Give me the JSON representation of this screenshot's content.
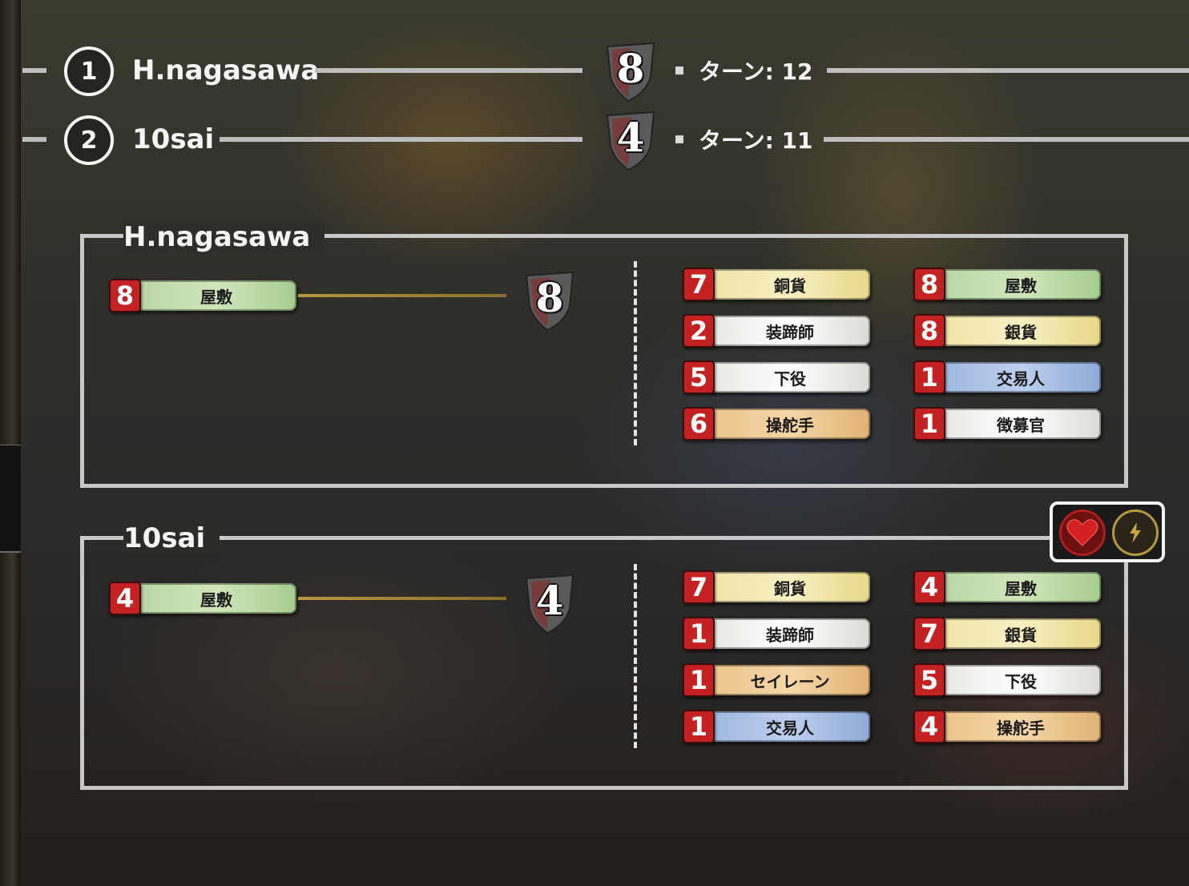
{
  "scoreboard": [
    {
      "rank": "1",
      "name": "H.nagasawa",
      "score": "8",
      "turn": "ターン: 12"
    },
    {
      "rank": "2",
      "name": "10sai",
      "score": "4",
      "turn": "ターン: 11"
    }
  ],
  "players": [
    {
      "name": "H.nagasawa",
      "summary_card": {
        "count": "8",
        "label": "屋敷",
        "color": "green"
      },
      "score": "8",
      "cards_left": [
        {
          "count": "7",
          "label": "銅貨",
          "color": "yellow"
        },
        {
          "count": "2",
          "label": "装蹄師",
          "color": "white"
        },
        {
          "count": "5",
          "label": "下役",
          "color": "white"
        },
        {
          "count": "6",
          "label": "操舵手",
          "color": "orange"
        }
      ],
      "cards_right": [
        {
          "count": "8",
          "label": "屋敷",
          "color": "green"
        },
        {
          "count": "8",
          "label": "銀貨",
          "color": "yellow"
        },
        {
          "count": "1",
          "label": "交易人",
          "color": "blue"
        },
        {
          "count": "1",
          "label": "徴募官",
          "color": "white"
        }
      ]
    },
    {
      "name": "10sai",
      "summary_card": {
        "count": "4",
        "label": "屋敷",
        "color": "green"
      },
      "score": "4",
      "cards_left": [
        {
          "count": "7",
          "label": "銅貨",
          "color": "yellow"
        },
        {
          "count": "1",
          "label": "装蹄師",
          "color": "white"
        },
        {
          "count": "1",
          "label": "セイレーン",
          "color": "orange"
        },
        {
          "count": "1",
          "label": "交易人",
          "color": "blue"
        }
      ],
      "cards_right": [
        {
          "count": "4",
          "label": "屋敷",
          "color": "green"
        },
        {
          "count": "7",
          "label": "銀貨",
          "color": "yellow"
        },
        {
          "count": "5",
          "label": "下役",
          "color": "white"
        },
        {
          "count": "4",
          "label": "操舵手",
          "color": "orange"
        }
      ]
    }
  ],
  "reaction_icons": [
    "heart-icon",
    "lightning-icon"
  ],
  "colors": {
    "badge_red": "#c42222",
    "frame": "#c8c8c8",
    "heart": "#d42020",
    "bolt": "#c9a83a"
  }
}
